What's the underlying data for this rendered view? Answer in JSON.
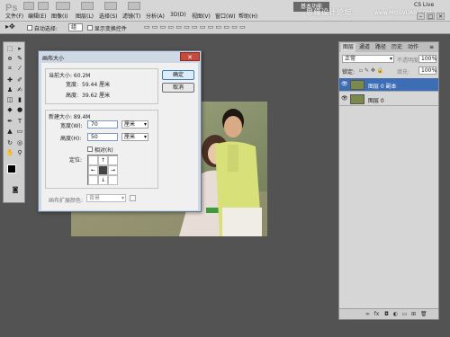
{
  "app": {
    "logo": "Ps"
  },
  "menu": [
    "文件(F)",
    "编辑(E)",
    "图像(I)",
    "图层(L)",
    "选择(S)",
    "滤镜(T)",
    "分析(A)",
    "3D(D)",
    "视图(V)",
    "窗口(W)",
    "帮助(H)"
  ],
  "header": {
    "workspace": "基本功能",
    "cs_live": "CS Live",
    "watermark": "思缘设计论坛",
    "watermark_url": "www.MISSVUAN.COM"
  },
  "options": {
    "auto_select_label": "自动选择:",
    "auto_select_value": "组",
    "show_transform_label": "显示变换控件"
  },
  "dialog": {
    "title": "画布大小",
    "current_size_label": "当前大小: 60.2M",
    "current_width_label": "宽度:",
    "current_width_value": "59.44 厘米",
    "current_height_label": "高度:",
    "current_height_value": "39.62 厘米",
    "new_size_label": "新建大小: 89.4M",
    "width_label": "宽度(W):",
    "width_value": "70",
    "height_label": "高度(H):",
    "height_value": "50",
    "unit": "厘米",
    "relative_label": "相对(R)",
    "anchor_label": "定位:",
    "extension_color_label": "画布扩展颜色:",
    "extension_color_value": "背景",
    "ok_label": "确定",
    "cancel_label": "取消"
  },
  "layers": {
    "tabs": [
      "图层",
      "通道",
      "路径",
      "历史",
      "动作"
    ],
    "blend_mode": "正常",
    "opacity_label": "不透明度:",
    "opacity_value": "100%",
    "lock_label": "锁定:",
    "fill_label": "填充:",
    "fill_value": "100%",
    "items": [
      {
        "name": "图层 0 副本",
        "selected": true
      },
      {
        "name": "图层 0",
        "selected": false
      }
    ]
  }
}
